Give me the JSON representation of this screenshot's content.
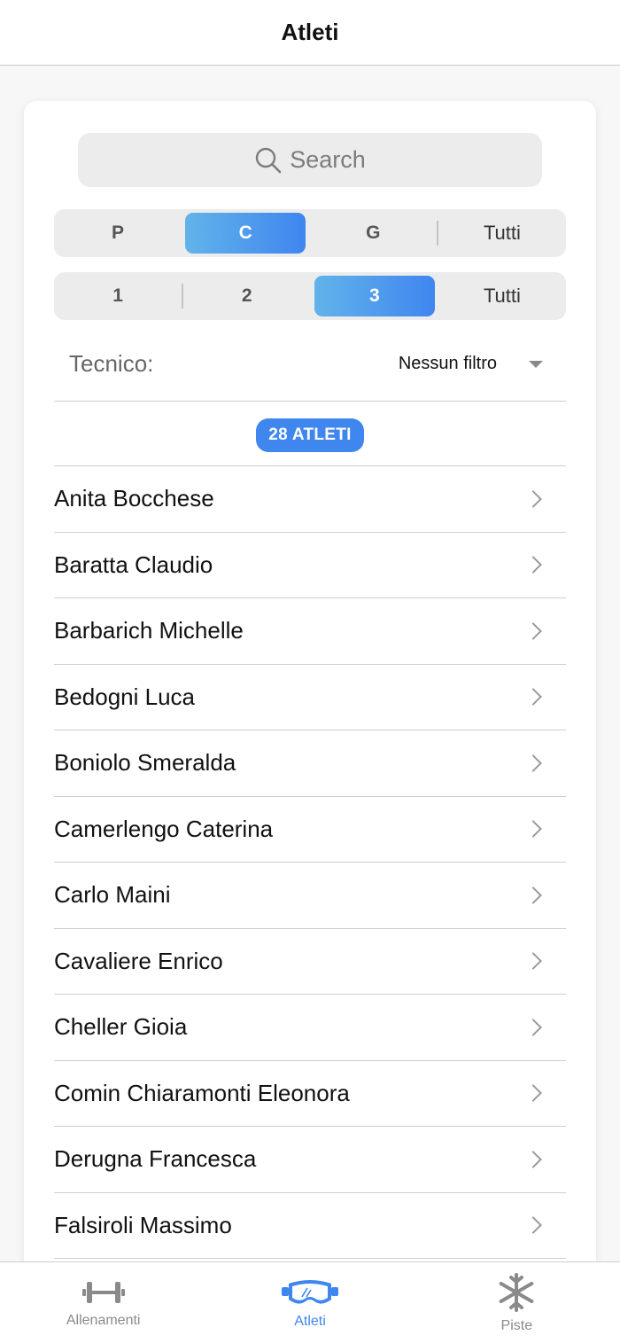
{
  "header": {
    "title": "Atleti"
  },
  "search": {
    "placeholder": "Search"
  },
  "category_filter": {
    "options": [
      "P",
      "C",
      "G",
      "Tutti"
    ],
    "selected": "C"
  },
  "level_filter": {
    "options": [
      "1",
      "2",
      "3",
      "Tutti"
    ],
    "selected": "3"
  },
  "tecnico": {
    "label": "Tecnico:",
    "value": "Nessun filtro"
  },
  "count_badge": "28 ATLETI",
  "athletes": [
    "Anita Bocchese",
    "Baratta Claudio",
    "Barbarich Michelle",
    "Bedogni Luca",
    "Boniolo Smeralda",
    "Camerlengo Caterina",
    "Carlo Maini",
    "Cavaliere Enrico",
    "Cheller Gioia",
    "Comin Chiaramonti Eleonora",
    "Derugna Francesca",
    "Falsiroli Massimo"
  ],
  "tabs": [
    {
      "label": "Allenamenti",
      "icon": "dumbbell-icon",
      "active": false
    },
    {
      "label": "Atleti",
      "icon": "ski-goggles-icon",
      "active": true
    },
    {
      "label": "Piste",
      "icon": "snowflake-icon",
      "active": false
    }
  ],
  "colors": {
    "accent": "#3f86ef",
    "accent_light": "#62b3ea",
    "inactive": "#8a8a8a"
  }
}
